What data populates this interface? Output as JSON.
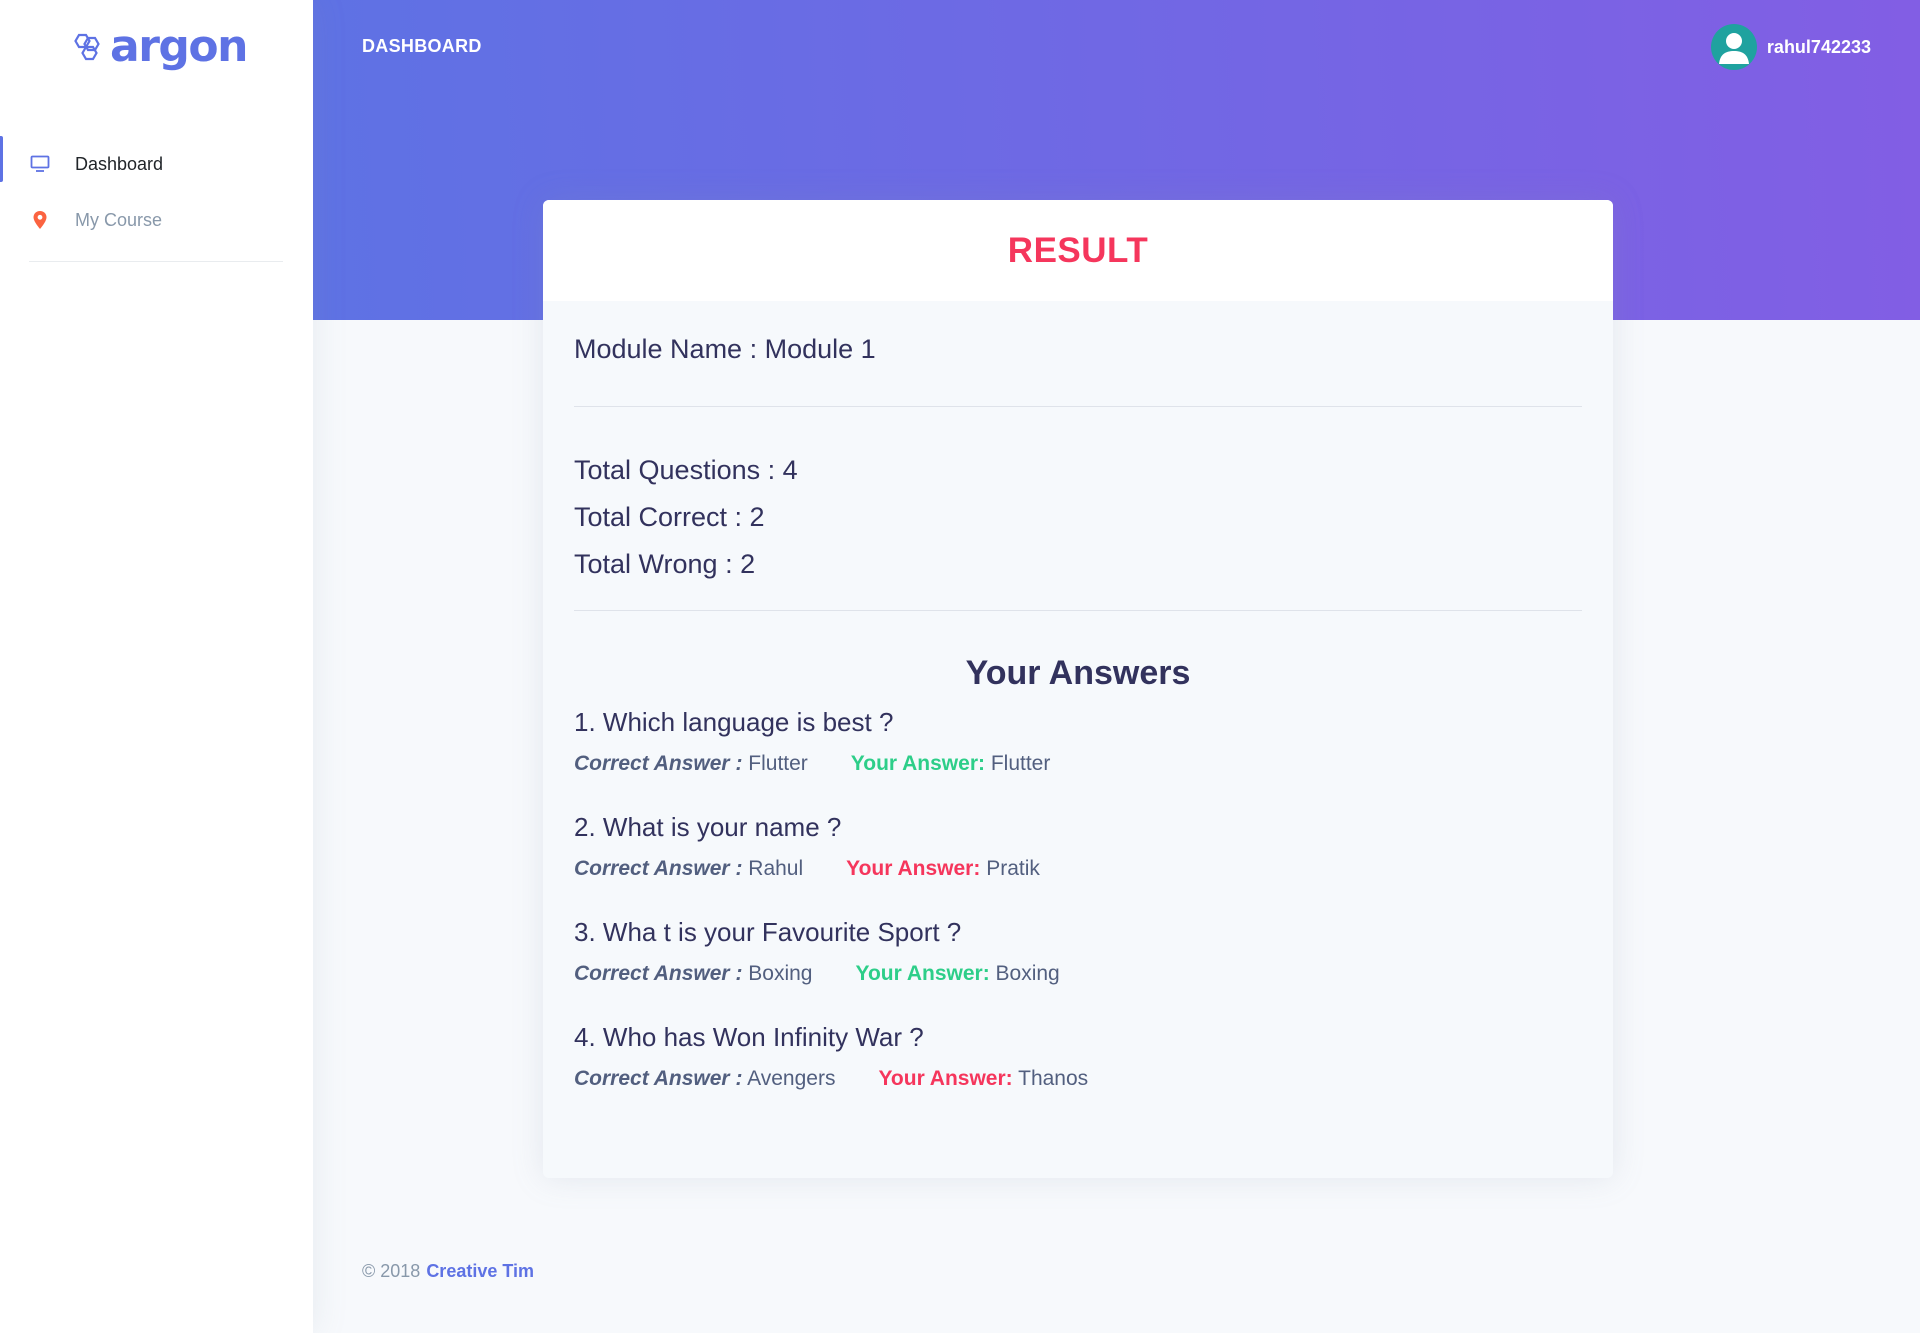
{
  "brand": {
    "name": "argon"
  },
  "sidebar": {
    "items": [
      {
        "label": "Dashboard",
        "icon": "monitor-icon"
      },
      {
        "label": "My Course",
        "icon": "location-pin-icon"
      }
    ]
  },
  "header": {
    "title": "DASHBOARD",
    "username": "rahul742233"
  },
  "result": {
    "title": "RESULT",
    "module_name": "Module Name : Module 1",
    "total_questions": "Total Questions : 4",
    "total_correct": "Total Correct : 2",
    "total_wrong": "Total Wrong : 2",
    "answers_title": "Your Answers",
    "correct_label": "Correct Answer :",
    "your_label": "Your Answer:",
    "questions": [
      {
        "text": "1. Which language is best ?",
        "correct": "Flutter",
        "yours": "Flutter",
        "is_correct": true
      },
      {
        "text": "2. What is your name ?",
        "correct": "Rahul",
        "yours": "Pratik",
        "is_correct": false
      },
      {
        "text": "3. Wha t is your Favourite Sport ?",
        "correct": "Boxing",
        "yours": "Boxing",
        "is_correct": true
      },
      {
        "text": "4. Who has Won Infinity War ?",
        "correct": "Avengers",
        "yours": "Thanos",
        "is_correct": false
      }
    ]
  },
  "footer": {
    "copyright": "© 2018",
    "link": "Creative Tim"
  },
  "colors": {
    "primary": "#5e72e4",
    "gradient_end": "#825ee4",
    "danger": "#f5365c",
    "success": "#2dce89"
  }
}
